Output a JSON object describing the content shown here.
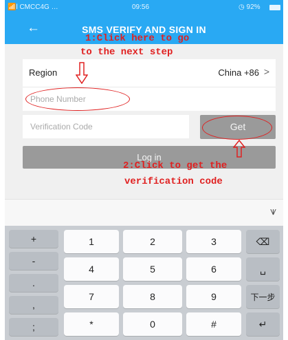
{
  "status_bar": {
    "carrier": "📶l CMCC4G …",
    "time": "09:56",
    "battery": "◷ 92%"
  },
  "header": {
    "back_icon": "←",
    "title": "SMS VERIFY AND SIGN IN"
  },
  "form": {
    "region_label": "Region",
    "region_value": "China +86",
    "region_chevron": ">",
    "phone_placeholder": "Phone Number",
    "code_placeholder": "Verification Code",
    "get_label": "Get",
    "login_label": "Log in"
  },
  "annotations": {
    "step1_line1": "1:Click here to go",
    "step1_line2": "to the next step",
    "step2_line1": "2:Click to get the",
    "step2_line2": "verification code",
    "color": "#e02020"
  },
  "keyboard": {
    "hide_icon": "⩛",
    "side_keys": [
      "+",
      "-",
      ".",
      ",",
      ";"
    ],
    "rows": [
      [
        "1",
        "2",
        "3"
      ],
      [
        "4",
        "5",
        "6"
      ],
      [
        "7",
        "8",
        "9"
      ],
      [
        "*",
        "0",
        "#"
      ]
    ],
    "action_keys": [
      "⌫",
      "␣",
      "下一步",
      "↵"
    ]
  },
  "colors": {
    "header": "#29a9f3",
    "button_disabled": "#9a9a9a",
    "keyboard_bg": "#c9cdd2"
  }
}
